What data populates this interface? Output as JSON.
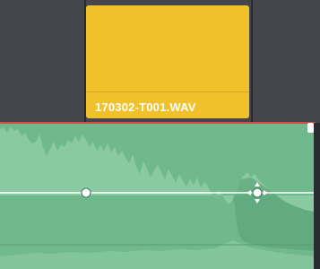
{
  "video_track": {
    "clip": {
      "name": "170302-T001.WAV",
      "color": "#f1c12b"
    }
  },
  "audio_track": {
    "clip": {
      "color": "#6fb98c",
      "selection_border_color": "#d84b43",
      "waveform_color": "#8fcda6",
      "volume_line_color": "#ffffff"
    },
    "keyframes": [
      {
        "name": "keyframe-1",
        "state": "normal"
      },
      {
        "name": "keyframe-2",
        "state": "hover"
      }
    ]
  },
  "icons": [
    "trim-handle-icon",
    "keyframe-icon",
    "move-cursor-icon"
  ]
}
